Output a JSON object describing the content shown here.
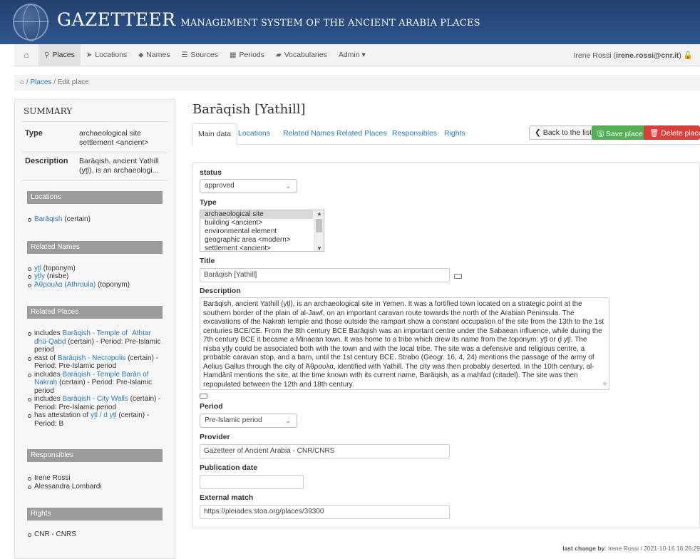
{
  "app": {
    "title": "GAZETTEER",
    "subtitle": "MANAGEMENT SYSTEM OF THE ANCIENT ARABIA PLACES"
  },
  "nav": {
    "items": [
      {
        "icon": "map-marker-icon",
        "glyph": "⚲",
        "label": "Places",
        "active": true
      },
      {
        "icon": "location-arrow-icon",
        "glyph": "➤",
        "label": "Locations"
      },
      {
        "icon": "tag-icon",
        "glyph": "⬥",
        "label": "Names"
      },
      {
        "icon": "list-icon",
        "glyph": "☰",
        "label": "Sources"
      },
      {
        "icon": "calendar-icon",
        "glyph": "▦",
        "label": "Periods"
      },
      {
        "icon": "book-icon",
        "glyph": "▰",
        "label": "Vocabularies"
      },
      {
        "label": "Admin ▾"
      }
    ],
    "user_name": "Irene Rossi",
    "user_email": "irene.rossi@cnr.it",
    "user_close": ")"
  },
  "breadcrumb": {
    "sep1": "/",
    "places": "Places",
    "sep2": "/",
    "current": "Edit place"
  },
  "summary": {
    "title": "SUMMARY",
    "type_label": "Type",
    "type_value": "archaeological site settlement <ancient>",
    "desc_label": "Description",
    "desc_value": "Barāqish, ancient Yathill (yṯl), is an archaeologi...",
    "locations_title": "Locations",
    "locations": [
      {
        "link": "Barāqish",
        "rest": " (certain)"
      }
    ],
    "names_title": "Related Names",
    "names": [
      {
        "link": "yṯl",
        "rest": " (toponym)"
      },
      {
        "link": "yṯly",
        "rest": " (nisbe)"
      },
      {
        "link": "Ἀθρουλα (Athroula)",
        "rest": " (toponym)"
      }
    ],
    "places_title": "Related Places",
    "places": [
      {
        "pre": "includes ",
        "link": "Barāqish - Temple of ʿAthtar dhū-Qabḍ",
        "rest": " (certain) - Period: Pre-Islamic period"
      },
      {
        "pre": "east of ",
        "link": "Barāqish - Necropolis",
        "rest": " (certain) - Period: Pre-Islamic period"
      },
      {
        "pre": "includes ",
        "link": "Barāqish - Temple Barān of Nakraḥ",
        "rest": " (certain) - Period: Pre-Islamic period"
      },
      {
        "pre": "includes ",
        "link": "Barāqish - City Walls",
        "rest": " (certain) - Period: Pre-Islamic period"
      },
      {
        "pre": "has attestation of ",
        "link": "yṯl / d yṯl",
        "rest": " (certain) - Period: B"
      }
    ],
    "resp_title": "Responsibles",
    "responsibles": [
      "Irene Rossi",
      "Alessandra Lombardi"
    ],
    "rights_title": "Rights",
    "rights": [
      "CNR - CNRS"
    ]
  },
  "page_title": "Barāqish [Yathill]",
  "tabs": [
    "Main data",
    "Locations",
    "Related Names",
    "Related Places",
    "Responsibles",
    "Rights"
  ],
  "buttons": {
    "back": "❮ Back to the list",
    "save": "🖫 Save place",
    "delete": "🗑 Delete place"
  },
  "form": {
    "status_label": "status",
    "status_value": "approved",
    "type_label": "Type",
    "type_options": [
      "archaeological site",
      "building <ancient>",
      "environmental element",
      "geographic area <modern>",
      "settlement <ancient>"
    ],
    "title_label": "Title",
    "title_value": "Barāqish [Yathill]",
    "desc_label": "Description",
    "desc_value": "Barāqish, ancient Yathill (yṯl), is an archaeological site in Yemen. It was a fortified town located on a strategic point at the southern border of the plain of al-Jawf, on an important caravan route towards the north of the Arabian Peninsula. The excavations of the Nakraḥ temple and those outside the rampart show a constant occupation of the site from the 13th to the 1st centuries BCE/CE. From the 8th century BCE Barāqish was an important centre under the Sabaean influence, while during the 7th century BCE it became a Minaean town. It was home to a tribe which drew its name from the toponym: yṯl or ḏ yṯl. The nisba yṯly could be associated both with the town and with the local tribe. The site was a defensive and religious centre, a probable caravan stop, and a barn, until the 1st century BCE. Strabo (Geogr. 16, 4, 24) mentions the passage of the army of Aelius Gallus through the city of Ἀθρουλα, identified with Yathill. The city was then probably deserted. In the 10th century, al-Hamdānī mentions the site, at the time known with its current name, Barāqish, as a maḥfad (citadel). The site was then repopulated between the 12th and 18th century.",
    "period_label": "Period",
    "period_value": "Pre-Islamic period",
    "provider_label": "Provider",
    "provider_value": "Gazetteer of Ancient Arabia - CNR/CNRS",
    "pubdate_label": "Publication date",
    "pubdate_value": "",
    "extmatch_label": "External match",
    "extmatch_value": "https://pleiades.stoa.org/places/39300"
  },
  "footer": {
    "label": "last change by",
    "value": ": Irene Rossi / 2021-10-16 16:26:29"
  }
}
